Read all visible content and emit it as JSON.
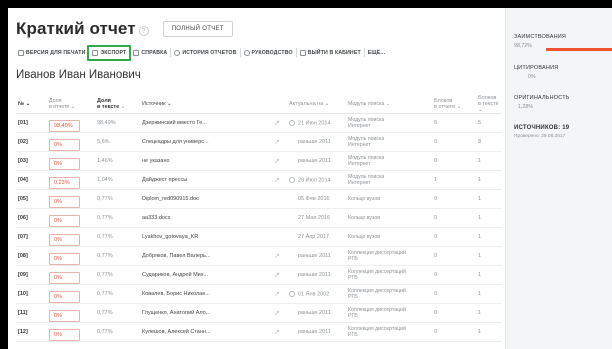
{
  "header": {
    "title": "Краткий отчет",
    "full_report_label": "полный отчет"
  },
  "toolbar": {
    "print_label": "ВЕРСИЯ ДЛЯ ПЕЧАТИ",
    "export_label": "ЭКСПОРТ",
    "help_label": "СПРАВКА",
    "history_label": "ИСТОРИЯ ОТЧЕТОВ",
    "manual_label": "РУКОВОДСТВО",
    "logout_label": "ВЫЙТИ В КАБИНЕТ",
    "more_label": "ЕЩЁ..."
  },
  "person": {
    "name": "Иванов Иван Иванович"
  },
  "table": {
    "columns": {
      "num": "№",
      "share_1": "Доля",
      "share_2": "в отчете",
      "in_text_1": "Доля",
      "in_text_2": "в тексте",
      "source": "Источник",
      "actual": "Актуальна на",
      "module": "Модуль поиска",
      "blocks_report_1": "Блоков",
      "blocks_report_2": "в отчете",
      "blocks_text_1": "Блоков",
      "blocks_text_2": "в тексте"
    },
    "rows": [
      {
        "num": "[01]",
        "share": "98,49%",
        "in_text": "98,49%",
        "source": "Дзержинский вместо Ге...",
        "actual": "21 Июн 2014",
        "module_1": "Модуль поиска",
        "module_2": "Интернет",
        "blocks_report": "5",
        "blocks_text": "5"
      },
      {
        "num": "[02]",
        "share": "0%",
        "in_text": "5,6%",
        "source": "Спецкадры для универс...",
        "actual": "раньше 2011",
        "module_1": "Модуль поиска",
        "module_2": "Интернет",
        "blocks_report": "0",
        "blocks_text": "8"
      },
      {
        "num": "[03]",
        "share": "0%",
        "in_text": "1,46%",
        "source": "не указано",
        "actual": "раньше 2011",
        "module_1": "Модуль поиска",
        "module_2": "Интернет",
        "blocks_report": "0",
        "blocks_text": "1"
      },
      {
        "num": "[04]",
        "share": "0,23%",
        "in_text": "1,04%",
        "source": "Дайджест прессы",
        "actual": "29 Июл 2014",
        "module_1": "Модуль поиска",
        "module_2": "Интернет",
        "blocks_report": "1",
        "blocks_text": "1"
      },
      {
        "num": "[05]",
        "share": "0%",
        "in_text": "0,77%",
        "source": "Diplom_red090915.doc",
        "actual": "05 Фев 2016",
        "module_1": "Кольцо вузов",
        "module_2": "",
        "blocks_report": "0",
        "blocks_text": "1"
      },
      {
        "num": "[06]",
        "share": "0%",
        "in_text": "0,77%",
        "source": "aa333.docx",
        "actual": "27 Мая 2016",
        "module_1": "Кольцо вузов",
        "module_2": "",
        "blocks_report": "0",
        "blocks_text": "1"
      },
      {
        "num": "[07]",
        "share": "0%",
        "in_text": "0,77%",
        "source": "Lyakhov_gotovaya_KR",
        "actual": "27 Апр 2017",
        "module_1": "Кольцо вузов",
        "module_2": "",
        "blocks_report": "0",
        "blocks_text": "1"
      },
      {
        "num": "[08]",
        "share": "0%",
        "in_text": "0,77%",
        "source": "Добряков, Павел Валерь...",
        "actual": "раньше 2011",
        "module_1": "Коллекция диссертаций",
        "module_2": "РГБ",
        "blocks_report": "0",
        "blocks_text": "1"
      },
      {
        "num": "[09]",
        "share": "0%",
        "in_text": "0,77%",
        "source": "Судариков, Андрей Мих...",
        "actual": "раньше 2011",
        "module_1": "Коллекция диссертаций",
        "module_2": "РГБ",
        "blocks_report": "0",
        "blocks_text": "1"
      },
      {
        "num": "[10]",
        "share": "0%",
        "in_text": "0,77%",
        "source": "Ковалев, Борис Николае...",
        "actual": "01 Янв 2002",
        "module_1": "Коллекция диссертаций",
        "module_2": "РГБ",
        "blocks_report": "0",
        "blocks_text": "1"
      },
      {
        "num": "[11]",
        "share": "0%",
        "in_text": "0,77%",
        "source": "Глущенко, Анатолий Ало...",
        "actual": "раньше 2011",
        "module_1": "Коллекция диссертаций",
        "module_2": "РГБ",
        "blocks_report": "0",
        "blocks_text": "1"
      },
      {
        "num": "[12]",
        "share": "0%",
        "in_text": "0,77%",
        "source": "Кулешов, Алексей Станн...",
        "actual": "раньше 2011",
        "module_1": "Коллекция диссертаций",
        "module_2": "РГБ",
        "blocks_report": "0",
        "blocks_text": "1"
      }
    ]
  },
  "sidebar": {
    "borrowing_label": "ЗАИМСТВОВАНИЯ",
    "borrowing_value": "98,72%",
    "borrowing_fraction": 0.9872,
    "citing_label": "ЦИТИРОВАНИЯ",
    "citing_value": "0%",
    "original_label": "ОРИГИНАЛЬНОСТЬ",
    "original_value": "1,28%",
    "sources_label": "ИСТОЧНИКОВ: 19",
    "checked_label": "Проверено: 29.08.2017"
  },
  "colors": {
    "accent_red": "#f0542e",
    "export_highlight": "#2fa84f"
  }
}
